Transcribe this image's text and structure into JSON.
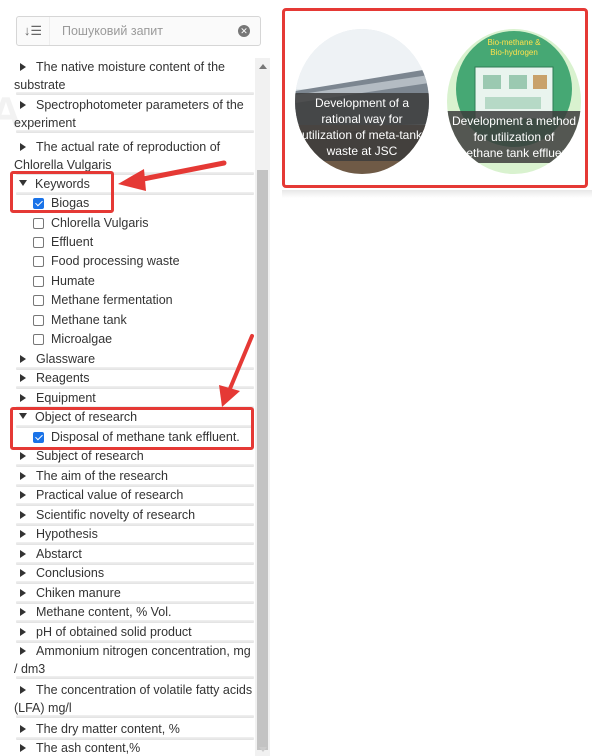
{
  "search": {
    "placeholder": "Пошуковий запит"
  },
  "tree": [
    {
      "type": "node",
      "label": "The native moisture content of the substrate",
      "expanded": false
    },
    {
      "type": "node",
      "label": "Spectrophotometer parameters of the experiment",
      "expanded": false
    },
    {
      "type": "node",
      "label": "The actual rate of reproduction of Chlorella Vulgaris",
      "expanded": false
    },
    {
      "type": "node",
      "label": "Keywords",
      "expanded": true
    },
    {
      "type": "check",
      "label": "Biogas",
      "checked": true
    },
    {
      "type": "check",
      "label": "Chlorella Vulgaris",
      "checked": false
    },
    {
      "type": "check",
      "label": "Effluent",
      "checked": false
    },
    {
      "type": "check",
      "label": "Food processing waste",
      "checked": false
    },
    {
      "type": "check",
      "label": "Humate",
      "checked": false
    },
    {
      "type": "check",
      "label": "Methane fermentation",
      "checked": false
    },
    {
      "type": "check",
      "label": "Methane tank",
      "checked": false
    },
    {
      "type": "check",
      "label": "Microalgae",
      "checked": false
    },
    {
      "type": "node",
      "label": "Glassware",
      "expanded": false
    },
    {
      "type": "node",
      "label": "Reagents",
      "expanded": false
    },
    {
      "type": "node",
      "label": "Equipment",
      "expanded": false
    },
    {
      "type": "node",
      "label": "Object of research",
      "expanded": true
    },
    {
      "type": "check",
      "label": "Disposal of methane tank effluent.",
      "checked": true
    },
    {
      "type": "node",
      "label": "Subject of research",
      "expanded": false
    },
    {
      "type": "node",
      "label": "The aim of the research",
      "expanded": false
    },
    {
      "type": "node",
      "label": "Practical value of research",
      "expanded": false
    },
    {
      "type": "node",
      "label": "Scientific novelty of research",
      "expanded": false
    },
    {
      "type": "node",
      "label": "Hypothesis",
      "expanded": false
    },
    {
      "type": "node",
      "label": "Abstarct",
      "expanded": false
    },
    {
      "type": "node",
      "label": "Conclusions",
      "expanded": false
    },
    {
      "type": "node",
      "label": "Chiken manure",
      "expanded": false
    },
    {
      "type": "node",
      "label": "Methane content, % Vol.",
      "expanded": false
    },
    {
      "type": "node",
      "label": "pH of obtained solid product",
      "expanded": false
    },
    {
      "type": "node",
      "label": "Ammonium nitrogen concentration, mg / dm3",
      "expanded": false
    },
    {
      "type": "node",
      "label": "The concentration of volatile fatty acids (LFA) mg/l",
      "expanded": false
    },
    {
      "type": "node",
      "label": "The dry matter content, %",
      "expanded": false
    },
    {
      "type": "node",
      "label": "The ash content,%",
      "expanded": false
    }
  ],
  "results": [
    {
      "title": "Development of a rational way for utilization of meta-tank waste at JSC"
    },
    {
      "title": "Development a method for utilization of methane tank effluent",
      "image_text": "Bio-methane & Bio-hydrogen"
    }
  ],
  "colors": {
    "highlight": "#e53935",
    "checkbox": "#1a73e8"
  }
}
